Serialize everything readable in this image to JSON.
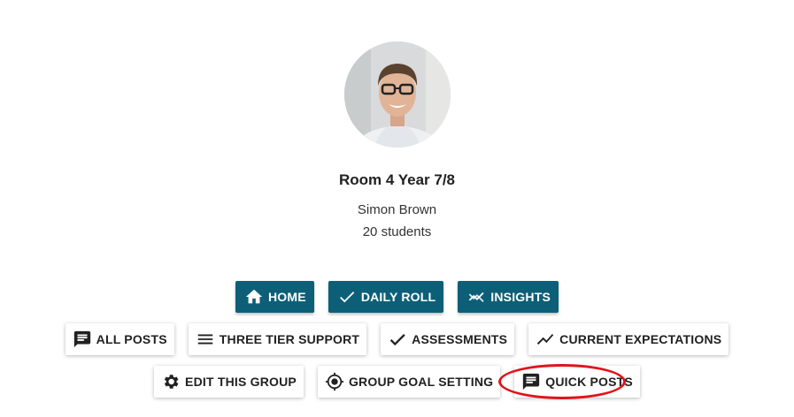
{
  "profile": {
    "group_name": "Room 4 Year 7/8",
    "teacher": "Simon Brown",
    "student_count": "20 students"
  },
  "nav_primary": [
    {
      "label": "HOME",
      "icon": "home-icon"
    },
    {
      "label": "DAILY ROLL",
      "icon": "check-icon"
    },
    {
      "label": "INSIGHTS",
      "icon": "insights-icon"
    }
  ],
  "nav_secondary": [
    {
      "label": "ALL POSTS",
      "icon": "comment-icon"
    },
    {
      "label": "THREE TIER SUPPORT",
      "icon": "menu-icon"
    },
    {
      "label": "ASSESSMENTS",
      "icon": "checkmark-icon"
    },
    {
      "label": "CURRENT EXPECTATIONS",
      "icon": "trend-icon"
    }
  ],
  "nav_tertiary": [
    {
      "label": "EDIT THIS GROUP",
      "icon": "gear-icon"
    },
    {
      "label": "GROUP GOAL SETTING",
      "icon": "target-icon"
    },
    {
      "label": "QUICK POSTS",
      "icon": "comment-icon"
    }
  ],
  "colors": {
    "primary": "#0d5f78",
    "highlight": "#e0141b"
  }
}
